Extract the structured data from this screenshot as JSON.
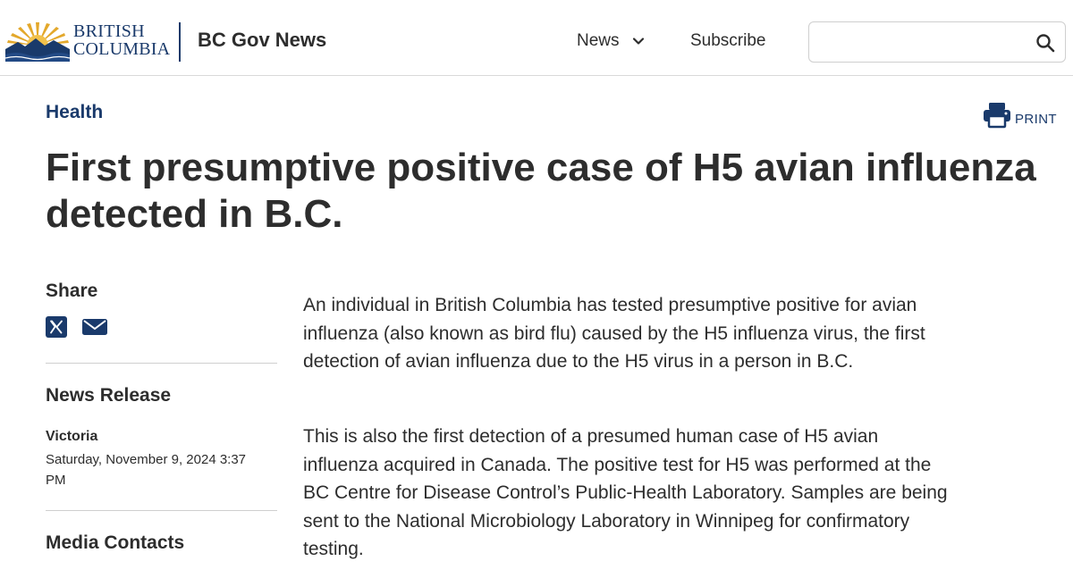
{
  "header": {
    "logo": {
      "line1": "BRITISH",
      "line2": "COLUMBIA"
    },
    "site_title": "BC Gov News",
    "nav": {
      "news_label": "News",
      "subscribe_label": "Subscribe"
    },
    "search": {
      "value": "",
      "placeholder": ""
    }
  },
  "article": {
    "category": "Health",
    "print_label": "PRINT",
    "headline": "First presumptive positive case of H5 avian influenza detected in B.C.",
    "paragraphs": [
      "An individual in British Columbia has tested presumptive positive for avian influenza (also known as bird flu) caused by the H5 influenza virus, the first detection of avian influenza due to the H5 virus in a person in B.C.",
      "This is also the first detection of a presumed human case of H5 avian influenza acquired in Canada. The positive test for H5 was performed at the BC Centre for Disease Control’s Public-Health Laboratory. Samples are being sent to the National Microbiology Laboratory in Winnipeg for confirmatory testing."
    ]
  },
  "sidebar": {
    "share_heading": "Share",
    "share_icons": [
      "x-icon",
      "email-icon"
    ],
    "release_type": "News Release",
    "location": "Victoria",
    "date": "Saturday, November 9, 2024 3:37 PM",
    "media_contacts_heading": "Media Contacts"
  },
  "colors": {
    "brand_blue": "#1a3a6b",
    "logo_gold": "#e3a82b",
    "text": "#2d2d2d",
    "divider": "#cfcfcf"
  }
}
